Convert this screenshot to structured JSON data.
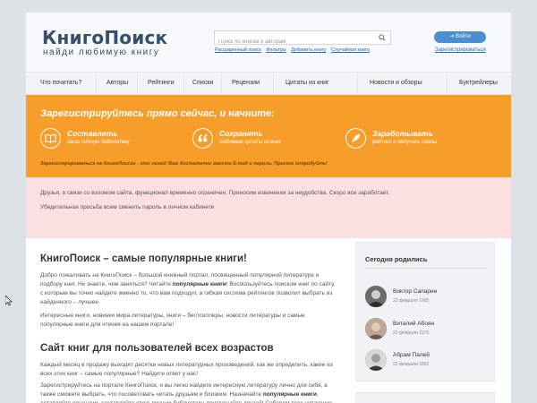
{
  "header": {
    "logo": "КнигоПоиск",
    "tagline": "найди любимую книгу",
    "search_placeholder": "Поиск по книгам и авторам",
    "search_links": [
      "Расширенный поиск",
      "Фильтры",
      "Добавить книгу",
      "Случайная книга"
    ],
    "login_label": "⇥ Войти",
    "register_label": "Зарегистрироваться"
  },
  "nav": [
    "Что почитать?",
    "Авторы",
    "Рейтинги",
    "Списки",
    "Рецензии",
    "Цитаты из книг",
    "Новости и обзоры",
    "Буктрейлеры"
  ],
  "banner": {
    "title": "Зарегистрируйтесь прямо сейчас, и начните:",
    "features": [
      {
        "title": "Составлять",
        "subtitle": "свою личную библиотеку",
        "icon": "book-icon"
      },
      {
        "title": "Сохранять",
        "subtitle": "любимые цитаты из книг",
        "icon": "quote-icon"
      },
      {
        "title": "Заработывать",
        "subtitle": "рейтинг и получать призы",
        "icon": "rocket-icon"
      }
    ],
    "note": "Зарегистрироваться на КнигоПоиске - это легко! Вам достаточно ввести E-mail и пароль. Просто попробуйте!"
  },
  "alert": {
    "line1": "Друзья, в связи со взломом сайта, функционал временно ограничен. Приносим извинения за неудобства. Скоро все заработает.",
    "line2": "Убедительная просьба всем сменить пароль в личном кабинете"
  },
  "main": {
    "title": "КнигоПоиск – самые популярные книги!",
    "p1_a": "Добро пожаловать на КнигоПоиск – большой книжный портал, посвященный популярной литературе и подбору книг. Не знаете, чем заняться? Читайте ",
    "p1_b": "популярные книги",
    "p1_c": "! Воспользуйтесь поиском книг по сайту, с которым вы точно найдете именно то, что вам подходит, а гибкая система рейтингов позволит выбрать из найденного – лучшее.",
    "p2": "Интересные книги, новинки мира литературы, книги – бестселлеры, новости литературы и самые популярные книги для чтения на нашем портале!",
    "section_title": "Сайт книг для пользователей всех возрастов",
    "p3": "Каждый месяц в продажу выходят десятки новых литературных произведений, как же определить, какие из всех этих книг – самые популярные? Найдите ответ у нас!",
    "p4_a": "Зарегистрируйтесь на портале КнигоПоиск, и вы легко найдете интересную литературу лично для себя, а также сможете выбрать, что посоветовать читать друзьям и близким. Назначайте ",
    "p4_b": "популярные книги",
    "p4_c": ", оставляйте рецензии, составляйте свою личную библиотеку, приглашайте друзей! Соберем всех читающих людей в одном месте!"
  },
  "sidebar": {
    "title": "Сегодня родились",
    "people": [
      {
        "name": "Виктор Сапарин",
        "date": "22 февраля 1905"
      },
      {
        "name": "Виталий Абоян",
        "date": "22 февраля 1975"
      },
      {
        "name": "Абрам Палей",
        "date": "22 февраля 1893"
      }
    ]
  },
  "colors": {
    "brand": "#35506a",
    "accent_orange": "#f69d2a",
    "button_blue": "#4b8fd0",
    "alert_pink": "#fcdfe1"
  }
}
